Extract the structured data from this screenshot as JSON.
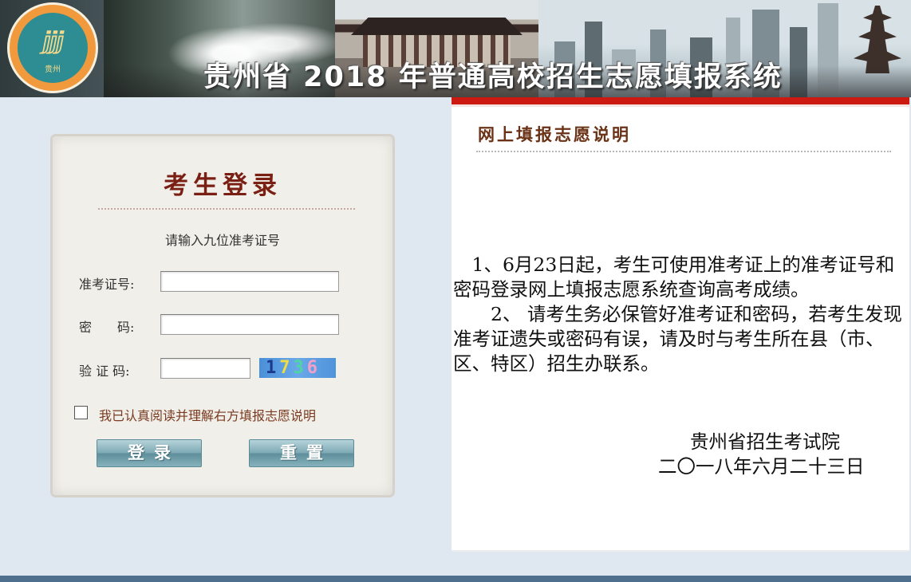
{
  "header": {
    "title": "贵州省 2018 年普通高校招生志愿填报系统",
    "logo_glyph": "ⅉⅉⅉ",
    "logo_sub": "贵州"
  },
  "login": {
    "title": "考生登录",
    "hint": "请输入九位准考证号",
    "exam_id_label": "准考证号:",
    "exam_id_value": "",
    "password_label": "密　　码:",
    "password_value": "",
    "captcha_label": "验 证 码:",
    "captcha_value": "",
    "captcha_digits": [
      "1",
      "7",
      "3",
      "6"
    ],
    "agree_label": "我已认真阅读并理解右方填报志愿说明",
    "agree_checked": false,
    "login_button": "登录",
    "reset_button": "重置"
  },
  "notice": {
    "title": "网上填报志愿说明",
    "paragraph1": "　1、6月23日起，考生可使用准考证上的准考证号和密码登录网上填报志愿系统查询高考成绩。",
    "paragraph2": "　　2、 请考生务必保管好准考证和密码，若考生发现准考证遗失或密码有误，请及时与考生所在县（市、区、特区）招生办联系。",
    "signature_org": "贵州省招生考试院",
    "signature_date": "二〇一八年六月二十三日"
  },
  "colors": {
    "accent_red": "#cc1a12",
    "login_title": "#7a1f14",
    "button": "#7eaab5",
    "page_bg": "#dfe7f0"
  }
}
